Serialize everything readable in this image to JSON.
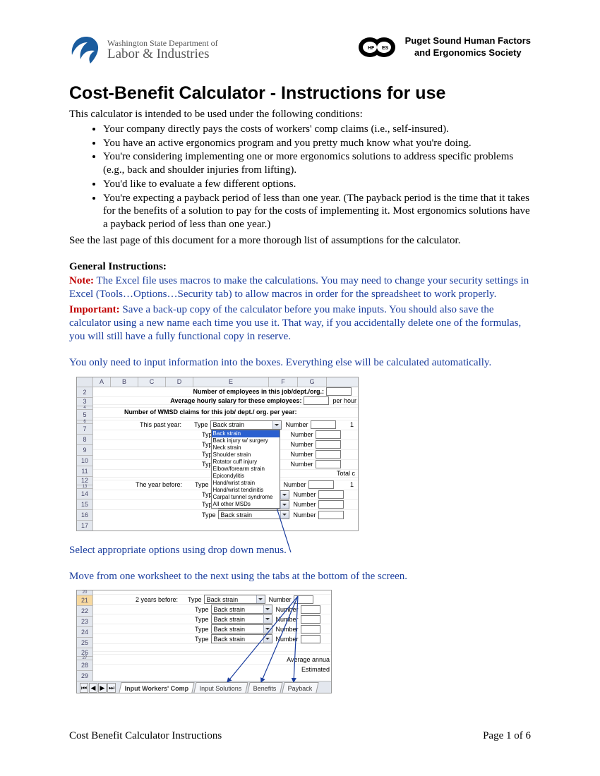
{
  "header": {
    "dept_line": "Washington State Department of",
    "agency_line": "Labor & Industries",
    "hfes_line1": "Puget Sound Human Factors",
    "hfes_line2": "and Ergonomics Society"
  },
  "title": "Cost-Benefit Calculator - Instructions for use",
  "intro": "This calculator is intended to be used under the following conditions:",
  "bullets": [
    "Your company directly pays the costs of workers' comp claims (i.e., self-insured).",
    "You have an active ergonomics program and you pretty much know what you're doing.",
    "You're considering implementing one or more ergonomics solutions to address specific problems (e.g., back and shoulder injuries from lifting).",
    "You'd like to evaluate a few different options.",
    "You're expecting a payback period of less than one year. (The payback period is the time that it takes for the benefits of a solution to pay for the costs of implementing it. Most ergonomics solutions have a payback period of less than one year.)"
  ],
  "see_last": "See the last page of this document for a more thorough list of assumptions for the calculator.",
  "gen_head": "General Instructions:",
  "note_label": "Note:",
  "note_text": " The Excel file uses macros to make the calculations. You may need to change your security settings in Excel (Tools…Options…Security tab) to allow macros in order for the spreadsheet to work properly.",
  "important_label": "Important:",
  "important_text": " Save a back-up copy of the calculator before you make inputs. You should also save the calculator using a new name each time you use it. That way, if you accidentally delete one of the formulas, you will still have a fully functional copy in reserve.",
  "auto_calc": "You only need to input information into the boxes. Everything else will be calculated automatically.",
  "ss1": {
    "cols": [
      "A",
      "B",
      "C",
      "D",
      "E",
      "F",
      "G"
    ],
    "rows_left": [
      "2",
      "3",
      "5",
      "7",
      "8",
      "9",
      "10",
      "11",
      "12",
      "14",
      "15",
      "16",
      "17"
    ],
    "num_employees": "Number of employees in this job/dept./org.:",
    "avg_salary": "Average hourly salary for these employees:",
    "per_hour": "per hour",
    "wmsd_head": "Number of WMSD claims for this job/ dept./ org. per year:",
    "this_past": "This past year:",
    "year_before": "The year before:",
    "type": "Type",
    "number": "Number",
    "one": "1",
    "total_c": "Total c",
    "dd_default": "Back strain",
    "dd_options": [
      "Back strain",
      "Back injury w/ surgery",
      "Neck strain",
      "Shoulder strain",
      "Rotator cuff injury",
      "Elbow/forearm strain",
      "Epicondylitis",
      "Hand/wrist strain",
      "Hand/wrist tendinitis",
      "Carpal tunnel syndrome",
      "All other MSDs"
    ]
  },
  "select_caption": "Select appropriate options using drop down menus.",
  "move_caption": "Move from one worksheet to the next using the tabs at the bottom of the screen.",
  "ss2": {
    "rows_left": [
      "20",
      "21",
      "22",
      "23",
      "24",
      "25",
      "26",
      "28",
      "29"
    ],
    "two_years": "2 years before:",
    "type": "Type",
    "number": "Number",
    "dd_default": "Back strain",
    "avg_annual": "Average annua",
    "estimated": "Estimated",
    "tabs": [
      "Input Workers' Comp",
      "Input Solutions",
      "Benefits",
      "Payback"
    ]
  },
  "footer_left": "Cost Benefit Calculator Instructions",
  "footer_right": "Page 1 of 6"
}
